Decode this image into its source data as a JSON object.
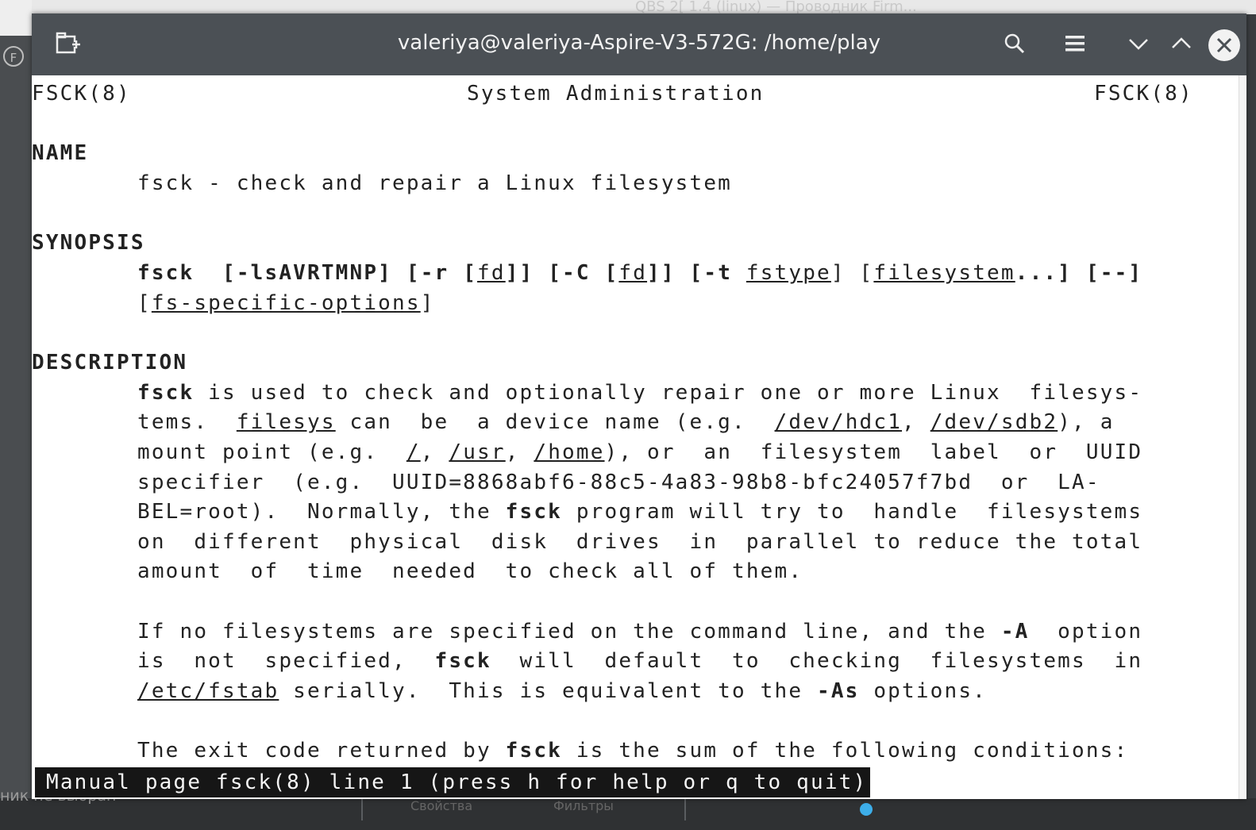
{
  "window": {
    "title": "valeriya@valeriya-Aspire-V3-572G: /home/play",
    "buttons": {
      "new_tab": "new-tab-icon",
      "search": "search-icon",
      "menu": "hamburger-menu-icon",
      "minimize": "chevron-down-icon",
      "maximize": "chevron-up-icon",
      "close": "close-icon"
    }
  },
  "background": {
    "top_text": "QBS 2[ 1.4 (linux) — Проводник Firm...",
    "left_circle": "F",
    "bottom_text": "ник не выбран",
    "bottom_tab_1": "Свойства",
    "bottom_tab_2": "Фильтры"
  },
  "man": {
    "header_left": "FSCK(8)",
    "header_center": "System Administration",
    "header_right": "FSCK(8)",
    "sections": {
      "name": "NAME",
      "synopsis": "SYNOPSIS",
      "description": "DESCRIPTION"
    },
    "name_line": "fsck - check and repair a Linux filesystem",
    "synopsis": {
      "cmd": "fsck",
      "opts1": "[-lsAVRTMNP]",
      "opt_r": "[-r [",
      "fd1": "fd",
      "opt_c": "]] [-C [",
      "fd2": "fd",
      "opt_t": "]] [-t ",
      "fstype": "fstype",
      "fs_open": "] [",
      "filesystem": "filesystem",
      "tail": "...] [--]",
      "line2_open": "[",
      "fs_specific": "fs-specific-options",
      "line2_close": "]"
    },
    "desc": {
      "l1_cmd": "fsck",
      "l1_rest": " is used to check and optionally repair one or more Linux  filesys-",
      "l2_a": "tems.  ",
      "l2_filesys": "filesys",
      "l2_b": " can  be  a device name (e.g.  ",
      "l2_dev1": "/dev/hdc1",
      "l2_c": ", ",
      "l2_dev2": "/dev/sdb2",
      "l2_d": "), a",
      "l3_a": "mount point (e.g.  ",
      "l3_root": "/",
      "l3_b": ", ",
      "l3_usr": "/usr",
      "l3_c": ", ",
      "l3_home": "/home",
      "l3_d": "), or  an  filesystem  label  or  UUID",
      "l4": "specifier  (e.g.  UUID=8868abf6-88c5-4a83-98b8-bfc24057f7bd  or  LA-",
      "l5_a": "BEL=root).  Normally, the ",
      "l5_cmd": "fsck",
      "l5_b": " program will try to  handle  filesystems",
      "l6": "on  different  physical  disk  drives  in  parallel to reduce the total",
      "l7": "amount  of  time  needed  to check all of them.",
      "p2_l1_a": "If no filesystems are specified on the command line, and the ",
      "p2_l1_opt": "-A",
      "p2_l1_b": "  option",
      "p2_l2_a": "is  not  specified,  ",
      "p2_l2_cmd": "fsck",
      "p2_l2_b": "  will  default  to  checking  filesystems  in",
      "p2_l3_path": "/etc/fstab",
      "p2_l3_a": " serially.  This is equivalent to the ",
      "p2_l3_opt": "-As",
      "p2_l3_b": " options.",
      "p3_a": "The exit code returned by ",
      "p3_cmd": "fsck",
      "p3_b": " is the sum of the following conditions:"
    },
    "status": "Manual page fsck(8) line 1 (press h for help or q to quit)"
  }
}
